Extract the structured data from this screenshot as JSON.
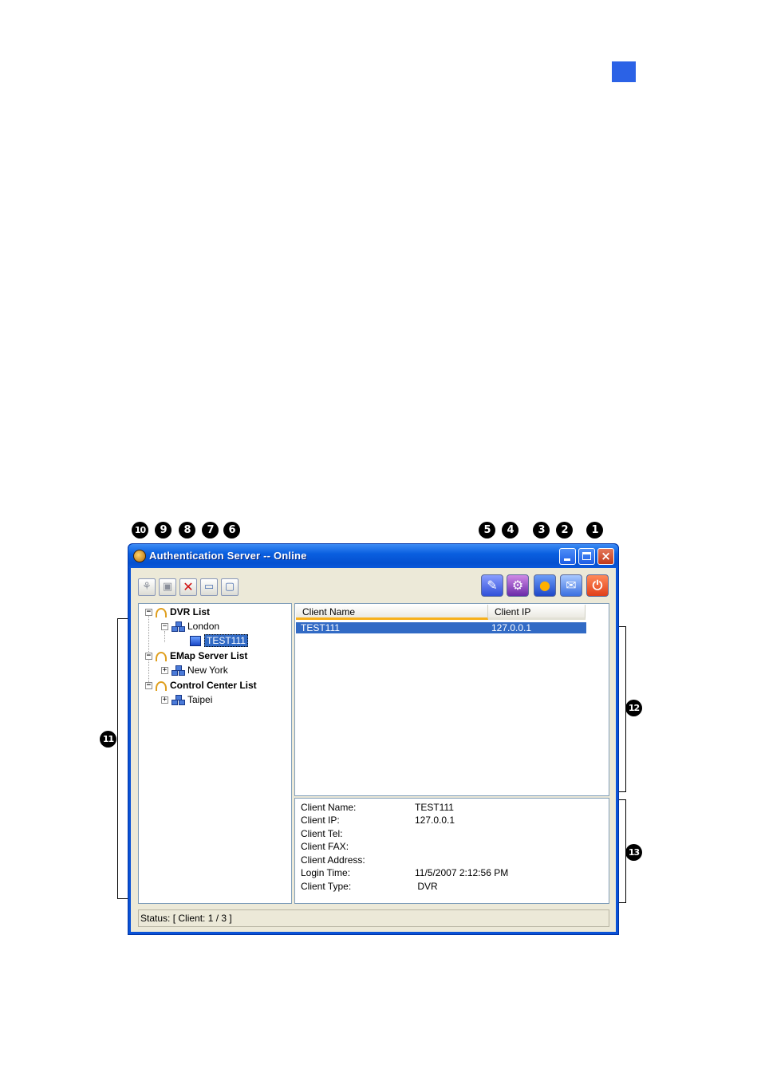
{
  "window": {
    "title": "Authentication Server -- Online"
  },
  "callouts": {
    "n1": "1",
    "n2": "2",
    "n3": "3",
    "n4": "4",
    "n5": "5",
    "n6": "6",
    "n7": "7",
    "n8": "8",
    "n9": "9",
    "n10": "10",
    "n11": "11",
    "n12": "12",
    "n13": "13"
  },
  "toolbar": {
    "left_icons": [
      "network-icon",
      "server-icon",
      "delete-icon",
      "window-icon",
      "comment-icon"
    ],
    "right_icons": [
      "pen-icon",
      "settings-icon",
      "users-icon",
      "mail-icon",
      "power-icon"
    ]
  },
  "tree": {
    "groups": [
      {
        "label": "DVR List",
        "children": [
          {
            "label": "London",
            "children": [
              {
                "label": "TEST111"
              }
            ]
          }
        ]
      },
      {
        "label": "EMap Server List",
        "children": [
          {
            "label": "New York"
          }
        ]
      },
      {
        "label": "Control Center List",
        "children": [
          {
            "label": "Taipei"
          }
        ]
      }
    ]
  },
  "client_list": {
    "columns": [
      "Client Name",
      "Client IP"
    ],
    "rows": [
      {
        "name": "TEST111",
        "ip": "127.0.0.1"
      }
    ]
  },
  "details": [
    {
      "label": "Client Name:",
      "value": "TEST111"
    },
    {
      "label": "Client IP:",
      "value": "127.0.0.1"
    },
    {
      "label": "Client Tel:",
      "value": ""
    },
    {
      "label": "Client FAX:",
      "value": ""
    },
    {
      "label": "Client Address:",
      "value": ""
    },
    {
      "label": "Login Time:",
      "value": "11/5/2007 2:12:56 PM"
    },
    {
      "label": "Client Type:",
      "value": " DVR"
    }
  ],
  "status": {
    "text": "Status: [ Client: 1 / 3 ]"
  },
  "colors": {
    "accent_square": "#2b62e6",
    "titlebar": "#0a58da",
    "selection": "#316ac5"
  }
}
